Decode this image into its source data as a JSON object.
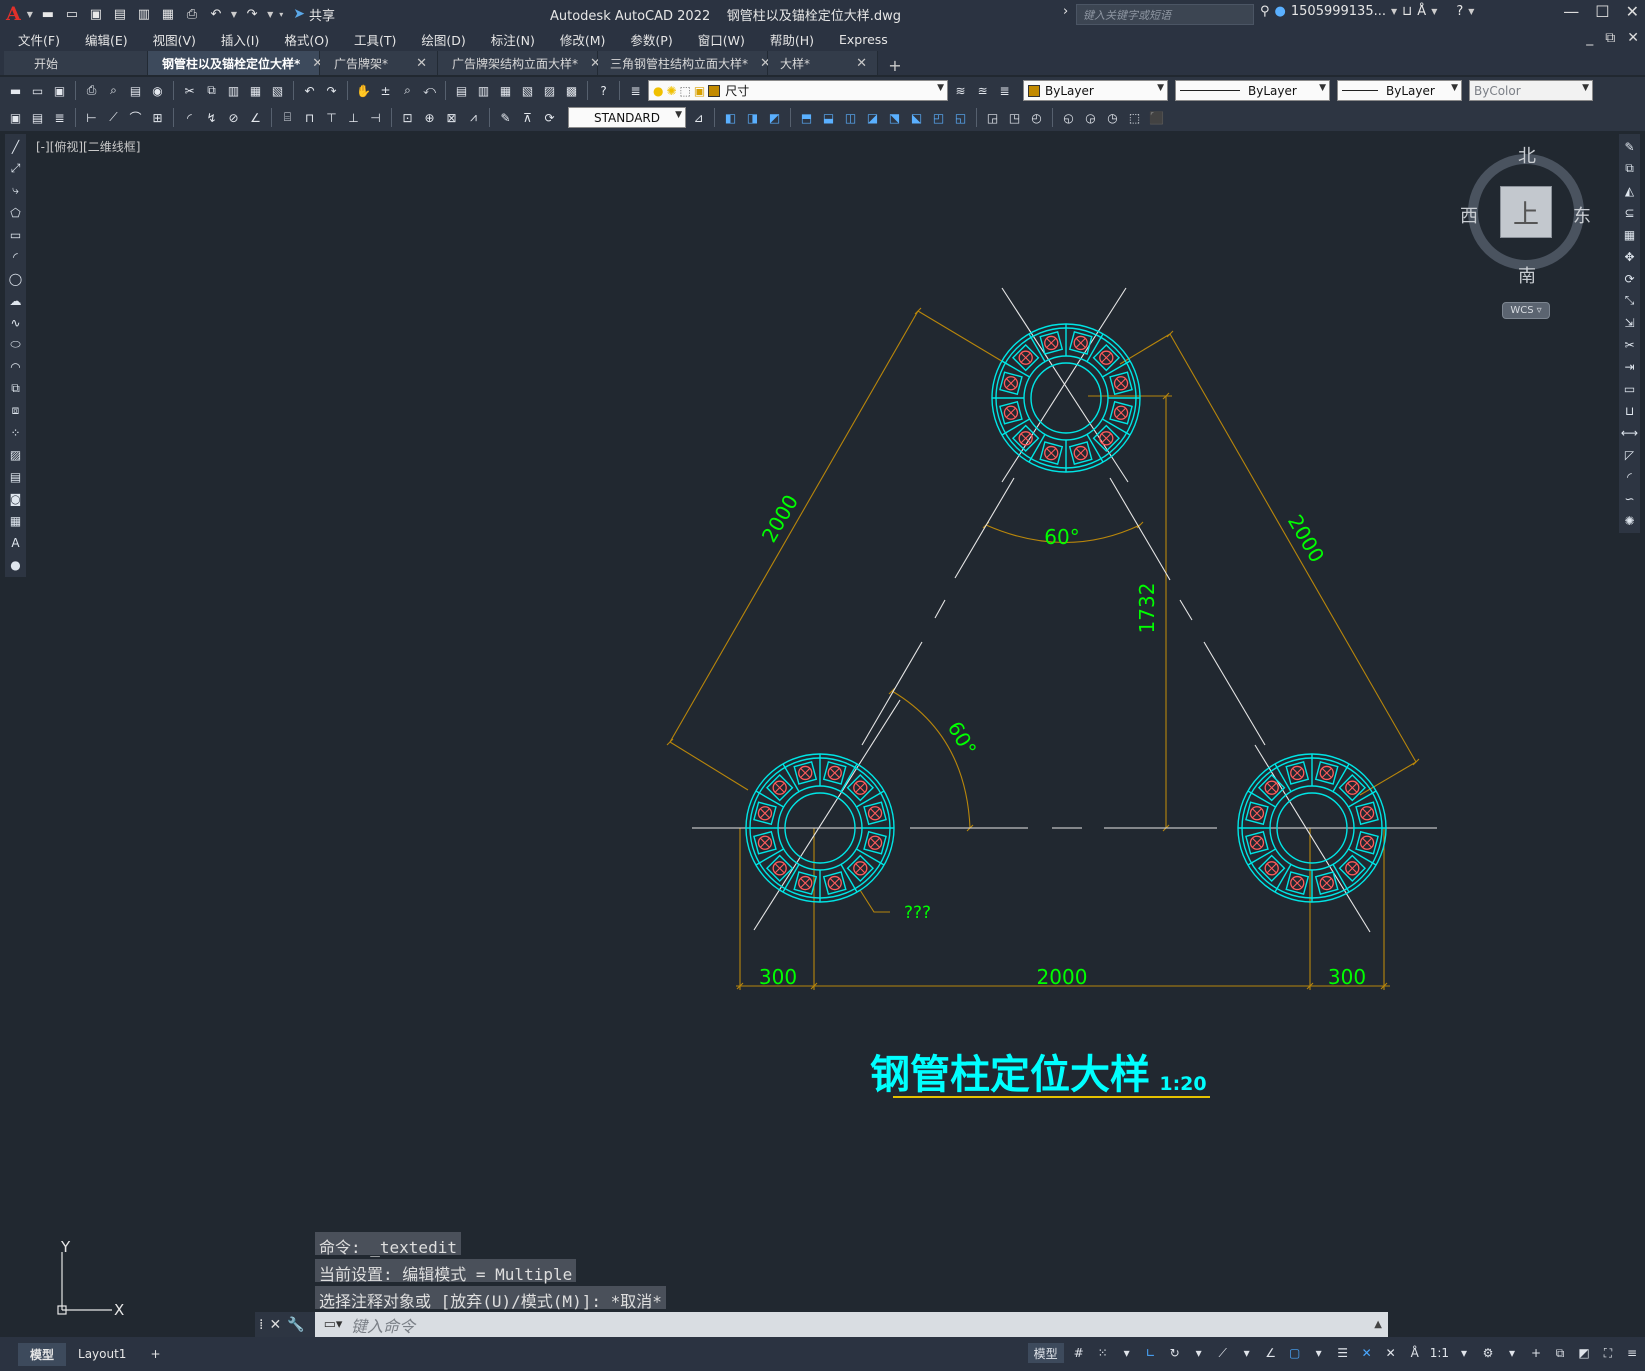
{
  "titlebar": {
    "app_title": "Autodesk AutoCAD 2022    钢管柱以及锚栓定位大样.dwg",
    "share_label": "共享",
    "search_placeholder": "键入关键字或短语",
    "user": "1505999135...",
    "logo": "A"
  },
  "menubar": {
    "items": [
      "文件(F)",
      "编辑(E)",
      "视图(V)",
      "插入(I)",
      "格式(O)",
      "工具(T)",
      "绘图(D)",
      "标注(N)",
      "修改(M)",
      "参数(P)",
      "窗口(W)",
      "帮助(H)",
      "Express"
    ]
  },
  "tabs": [
    {
      "label": "开始",
      "closable": false,
      "active": false
    },
    {
      "label": "钢管柱以及锚栓定位大样*",
      "closable": true,
      "active": true
    },
    {
      "label": "广告牌架*",
      "closable": true,
      "active": false
    },
    {
      "label": "广告牌架结构立面大样*",
      "closable": true,
      "active": false
    },
    {
      "label": "三角钢管柱结构立面大样*",
      "closable": true,
      "active": false
    },
    {
      "label": "大样*",
      "closable": true,
      "active": false
    }
  ],
  "toolbar": {
    "layer_name": "尺寸",
    "color": "ByLayer",
    "linetype": "ByLayer",
    "lineweight": "ByLayer",
    "plotstyle": "ByColor",
    "text_style": "STANDARD"
  },
  "viewport": {
    "label": "[-][俯视][二维线框]"
  },
  "viewcube": {
    "north": "北",
    "south": "南",
    "east": "东",
    "west": "西",
    "face": "上",
    "wcs": "WCS"
  },
  "drawing": {
    "dim_left_side": "2000",
    "dim_right_side": "2000",
    "dim_height": "1732",
    "angle_top": "60°",
    "angle_left": "60°",
    "dim_bottom_left": "300",
    "dim_bottom_mid": "2000",
    "dim_bottom_right": "300",
    "leader_text": "???",
    "title": "钢管柱定位大样",
    "scale": "1:20",
    "colors": {
      "dimension": "#b8860b",
      "dim_text": "#00ff00",
      "column": "#00e5e5",
      "anchor": "#ff5c5c",
      "centerline": "#e6e6e6",
      "title": "#00ffff",
      "underline": "#e6c200"
    }
  },
  "command": {
    "history": [
      "命令: _textedit",
      "当前设置: 编辑模式 = Multiple",
      "选择注释对象或 [放弃(U)/模式(M)]: *取消*"
    ],
    "placeholder": "键入命令"
  },
  "ucs": {
    "x": "X",
    "y": "Y"
  },
  "statusbar": {
    "layout_tabs": [
      "模型",
      "Layout1"
    ],
    "model_label": "模型",
    "scale": "1:1"
  }
}
